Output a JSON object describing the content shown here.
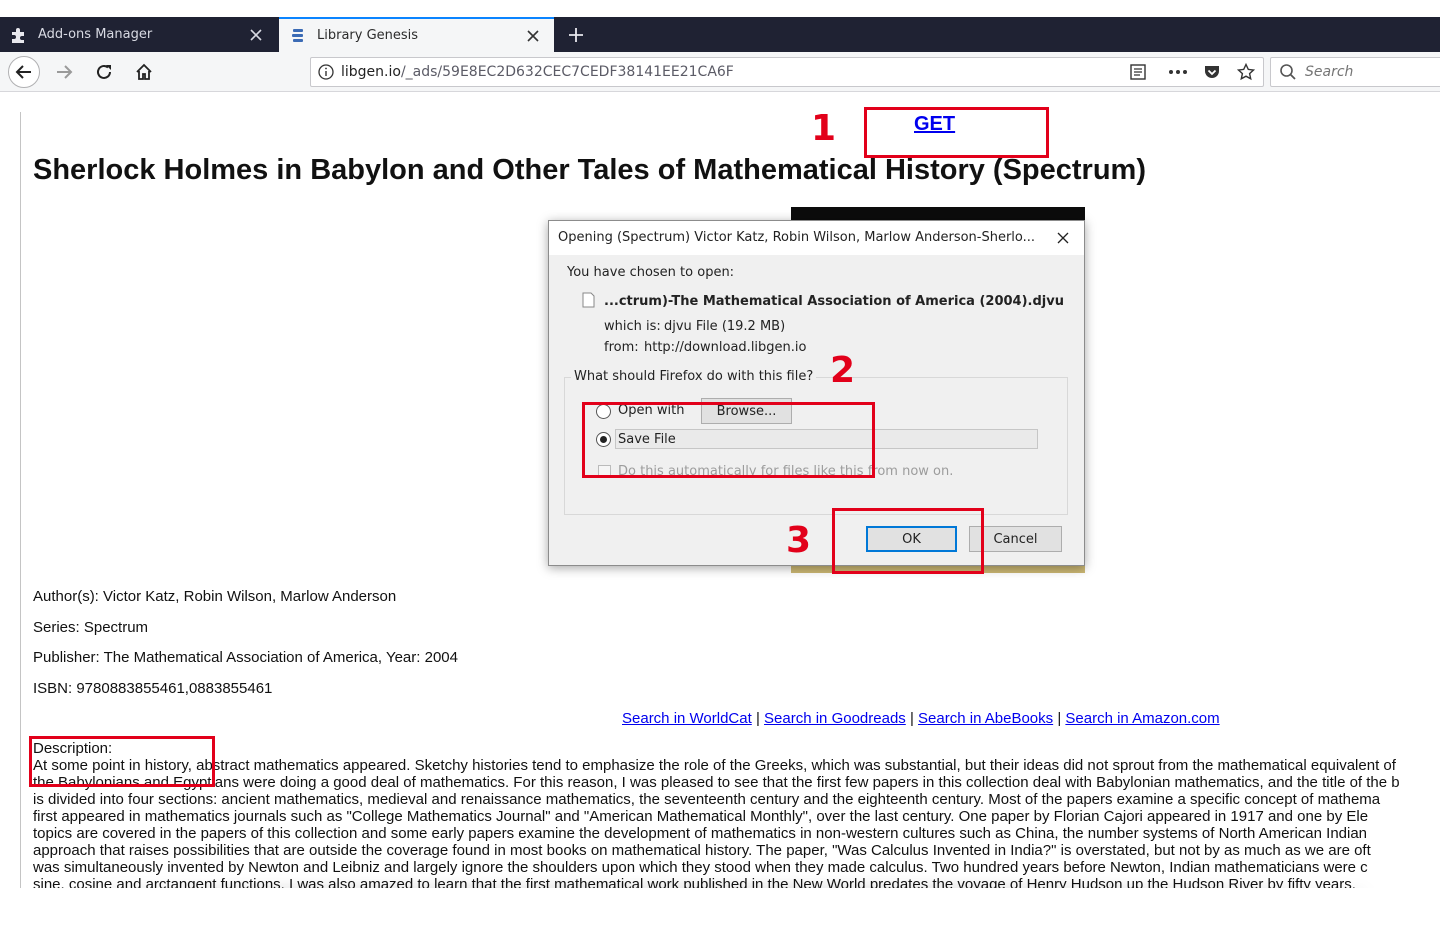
{
  "browser": {
    "tabs": [
      {
        "label": "Add-ons Manager",
        "icon": "puzzle-icon",
        "active": false
      },
      {
        "label": "Library Genesis",
        "icon": "libgen-icon",
        "active": true
      }
    ],
    "url_host": "libgen.io",
    "url_path": "/_ads/59E8EC2D632CEC7CEDF38141EE21CA6F",
    "search_placeholder": "Search",
    "accent_color": "#0a84ff"
  },
  "page": {
    "get_link": "GET",
    "title": "Sherlock Holmes in Babylon and Other Tales of Mathematical History (Spectrum)",
    "authors": "Author(s): Victor Katz, Robin Wilson, Marlow Anderson",
    "series": "Series: Spectrum",
    "publisher": "Publisher: The Mathematical Association of America, Year: 2004",
    "isbn": "ISBN: 9780883855461,0883855461",
    "search_links": [
      "Search in WorldCat",
      "Search in Goodreads",
      "Search in AbeBooks",
      "Search in Amazon.com"
    ],
    "separator": "|",
    "description_label": "Description:",
    "description_lines": [
      "At some point in history, abstract mathematics appeared. Sketchy histories tend to emphasize the role of the Greeks, which was substantial, but their ideas did not sprout from the mathematical equivalent of",
      "the Babylonians and Egyptians were doing a good deal of mathematics. For this reason, I was pleased to see that the first few papers in this collection deal with Babylonian mathematics, and the title of the b",
      "is divided into four sections: ancient mathematics, medieval and renaissance mathematics, the seventeenth century and the eighteenth century. Most of the papers examine a specific concept of mathema",
      "first appeared in mathematics journals such as \"College Mathematics Journal\" and \"American Mathematical Monthly\", over the last century. One paper by Florian Cajori appeared in 1917 and one by Ele",
      "topics are covered in the papers of this collection and some early papers examine the development of mathematics in non-western cultures such as China, the number systems of North American Indian",
      "approach that raises possibilities that are outside the coverage found in most books on mathematical history. The paper, \"Was Calculus Invented in India?\" is overstated, but not by as much as we are oft",
      "was simultaneously invented by Newton and Leibniz and largely ignore the shoulders upon which they stood when they made calculus. Two hundred years before Newton, Indian mathematicians were c",
      "sine, cosine and arctangent functions. I was also amazed to learn that the first mathematical work published in the New World predates the voyage of Henry Hudson up the Hudson River by fifty years."
    ]
  },
  "dialog": {
    "title": "Opening (Spectrum) Victor Katz, Robin Wilson, Marlow Anderson-Sherlo...",
    "chosen_label": "You have chosen to open:",
    "file_name": "...ctrum)-The Mathematical Association of America (2004).djvu",
    "which_is_label": "which is:",
    "which_is_value": "djvu File (19.2 MB)",
    "from_label": "from:",
    "from_value": "http://download.libgen.io",
    "question": "What should Firefox do with this file?",
    "open_with_label": "Open with",
    "browse_label": "Browse...",
    "save_file_label": "Save File",
    "auto_label": "Do this automatically for files like this from now on.",
    "selected_option": "Save File",
    "ok_label": "OK",
    "cancel_label": "Cancel"
  },
  "annotations": {
    "step1": "1",
    "step2": "2",
    "step3": "3",
    "color": "#e2001a"
  }
}
